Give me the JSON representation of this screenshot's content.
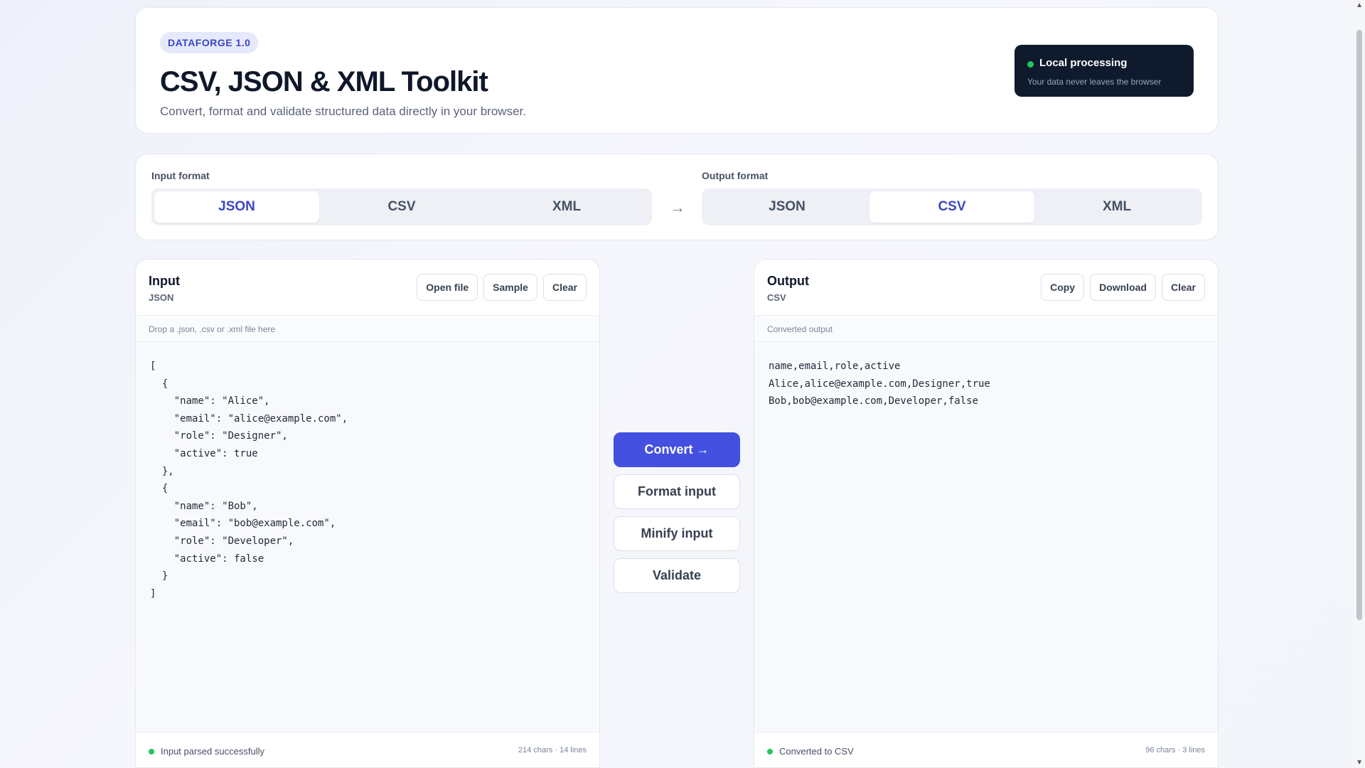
{
  "header": {
    "badge": "DATAFORGE 1.0",
    "title": "CSV, JSON & XML Toolkit",
    "subtitle": "Convert, format and validate structured data directly in your browser.",
    "local": {
      "title": "Local processing",
      "subtitle": "Your data never leaves the browser"
    }
  },
  "formats": {
    "input_label": "Input format",
    "output_label": "Output format",
    "arrow": "→",
    "input_options": [
      "JSON",
      "CSV",
      "XML"
    ],
    "input_selected": "JSON",
    "output_options": [
      "JSON",
      "CSV",
      "XML"
    ],
    "output_selected": "CSV"
  },
  "input_panel": {
    "title": "Input",
    "format": "JSON",
    "actions": [
      "Open file",
      "Sample",
      "Clear"
    ],
    "hint": "Drop a .json, .csv or .xml file here",
    "content": "[\n  {\n    \"name\": \"Alice\",\n    \"email\": \"alice@example.com\",\n    \"role\": \"Designer\",\n    \"active\": true\n  },\n  {\n    \"name\": \"Bob\",\n    \"email\": \"bob@example.com\",\n    \"role\": \"Developer\",\n    \"active\": false\n  }\n]",
    "status": "Input parsed successfully",
    "stats": "214 chars · 14 lines"
  },
  "output_panel": {
    "title": "Output",
    "format": "CSV",
    "actions": [
      "Copy",
      "Download",
      "Clear"
    ],
    "hint": "Converted output",
    "content": "name,email,role,active\nAlice,alice@example.com,Designer,true\nBob,bob@example.com,Developer,false",
    "status": "Converted to CSV",
    "stats": "96 chars · 3 lines"
  },
  "actions": {
    "convert": "Convert →",
    "format_input": "Format input",
    "minify_input": "Minify input",
    "validate": "Validate"
  },
  "colors": {
    "accent": "#4350e0",
    "badge_bg": "#e6e9fb",
    "status_ok": "#22c55e",
    "dark_box": "#0f1b2d"
  },
  "icons": {
    "status": "status-dot-icon",
    "arrow": "right-arrow-icon"
  }
}
